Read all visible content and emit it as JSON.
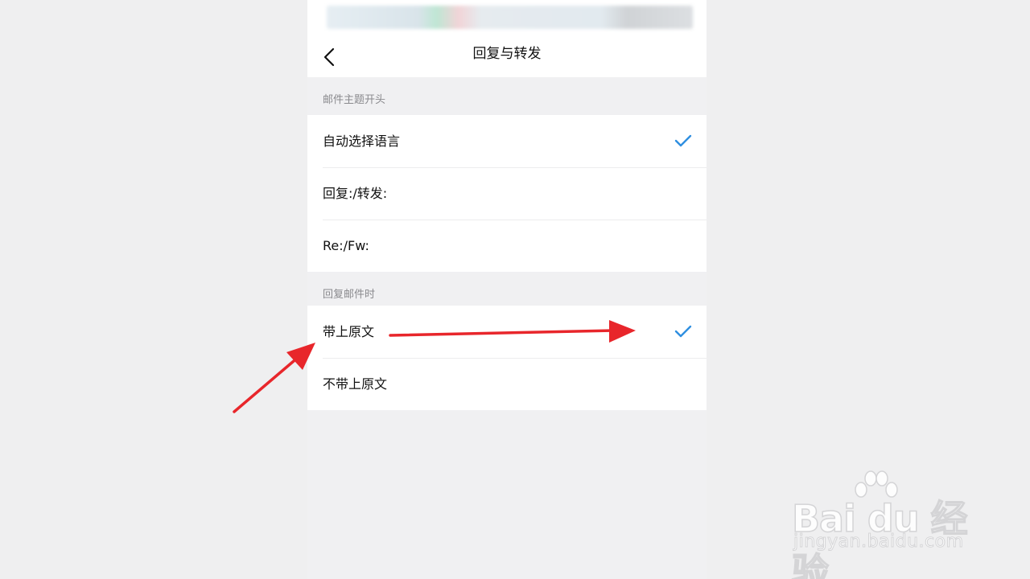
{
  "navbar": {
    "title": "回复与转发",
    "back_icon": "chevron-left-icon"
  },
  "subject_section": {
    "header": "邮件主题开头",
    "options": [
      {
        "label": "自动选择语言",
        "selected": true
      },
      {
        "label": "回复:/转发:",
        "selected": false
      },
      {
        "label": "Re:/Fw:",
        "selected": false
      }
    ]
  },
  "reply_section": {
    "header": "回复邮件时",
    "options": [
      {
        "label": "带上原文",
        "selected": true
      },
      {
        "label": "不带上原文",
        "selected": false
      }
    ]
  },
  "colors": {
    "accent": "#2f8fe0",
    "annotation_arrow": "#e8262b",
    "background": "#f0f0f2"
  },
  "watermark": {
    "logo": "Bai du 经验",
    "url": "jingyan.baidu.com"
  }
}
